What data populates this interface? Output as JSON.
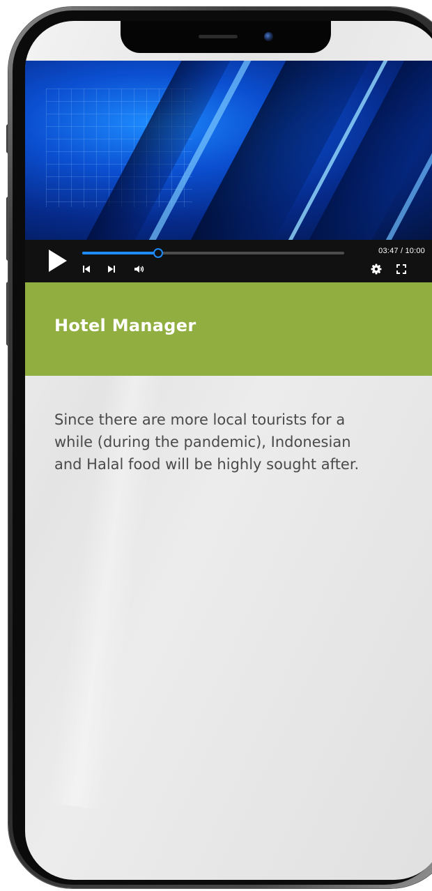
{
  "video_player": {
    "time_display": "03:47 / 10:00",
    "progress_fraction": 0.2903,
    "icons": [
      "play-icon",
      "skip-back-icon",
      "skip-forward-icon",
      "volume-icon",
      "settings-icon",
      "fullscreen-icon"
    ],
    "accent_color": "#1e8cff"
  },
  "header": {
    "title": "Hotel Manager",
    "background_color": "#91ae40"
  },
  "content": {
    "body": "Since there are more local tourists for a while (during the pandemic), Indonesian and Halal food will be highly sought after."
  }
}
